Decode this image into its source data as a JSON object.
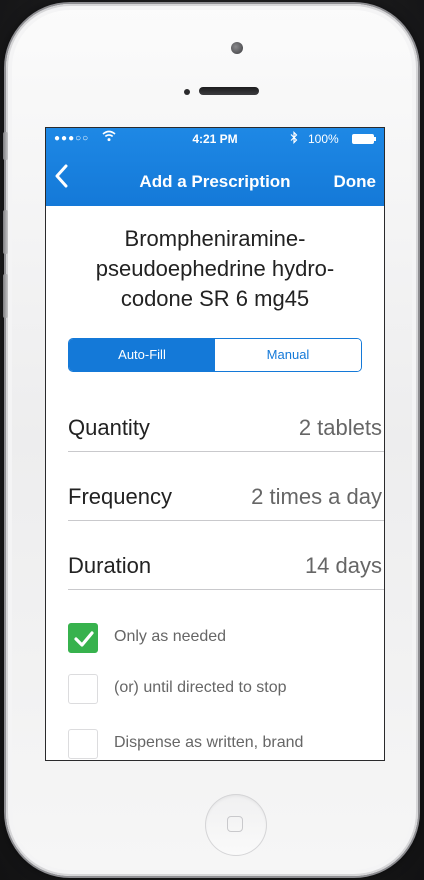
{
  "status_bar": {
    "signal": "●●●○○",
    "time": "4:21 PM",
    "battery": "100%"
  },
  "nav": {
    "back_icon": "chevron-left-icon",
    "title": "Add a Prescription",
    "done_label": "Done"
  },
  "drug": {
    "name_line1": "Brompheniramine-",
    "name_line2": "pseudoephedrine hydro-",
    "name_line3": "codone SR 6 mg45"
  },
  "mode_toggle": {
    "options": [
      "Auto-Fill",
      "Manual"
    ],
    "selected": "Auto-Fill"
  },
  "fields": [
    {
      "label": "Quantity",
      "value": "2 tablets"
    },
    {
      "label": "Frequency",
      "value": "2 times a day"
    },
    {
      "label": "Duration",
      "value": "14 days"
    }
  ],
  "options": [
    {
      "label": "Only as needed",
      "checked": true
    },
    {
      "label": "(or) until directed to stop",
      "checked": false
    },
    {
      "label": "Dispense as written, brand",
      "checked": false
    }
  ],
  "colors": {
    "accent": "#1479d8",
    "check_green": "#37b24d"
  }
}
